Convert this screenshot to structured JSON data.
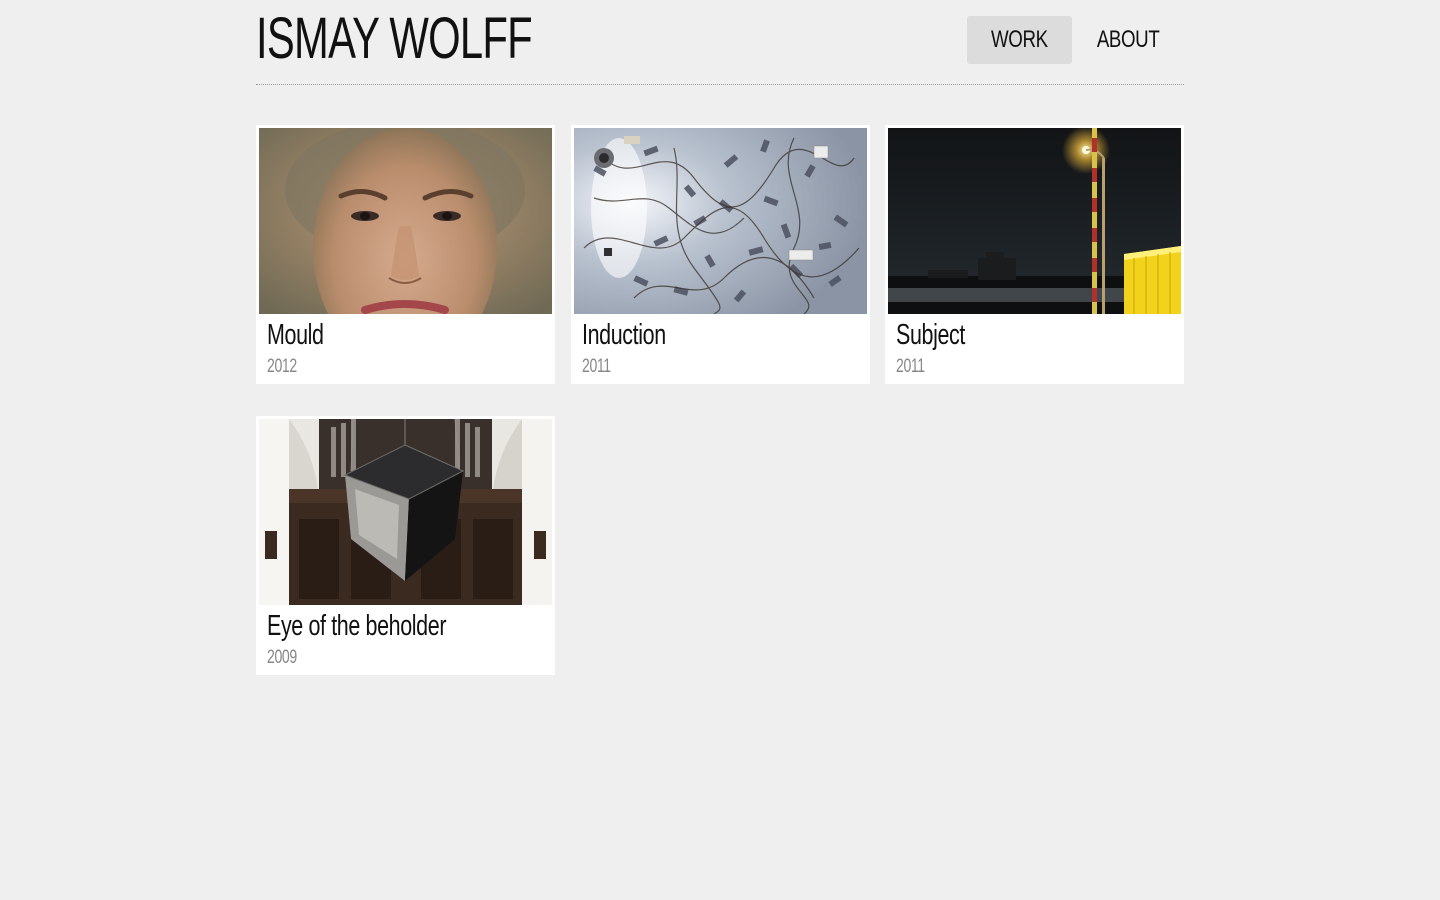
{
  "site": {
    "title": "ISMAY WOLFF"
  },
  "nav": {
    "items": [
      {
        "label": "WORK",
        "active": true
      },
      {
        "label": "ABOUT",
        "active": false
      }
    ]
  },
  "works": [
    {
      "title": "Mould",
      "year": "2012",
      "image": "face-composite-portrait"
    },
    {
      "title": "Induction",
      "year": "2011",
      "image": "wired-circuit-board-installation"
    },
    {
      "title": "Subject",
      "year": "2011",
      "image": "night-streetlight-harbour"
    },
    {
      "title": "Eye of the beholder",
      "year": "2009",
      "image": "mirrored-cube-in-church"
    }
  ],
  "colors": {
    "background": "#efefef",
    "card": "#ffffff",
    "nav_active": "#dcdcdc",
    "year_text": "#888888"
  }
}
